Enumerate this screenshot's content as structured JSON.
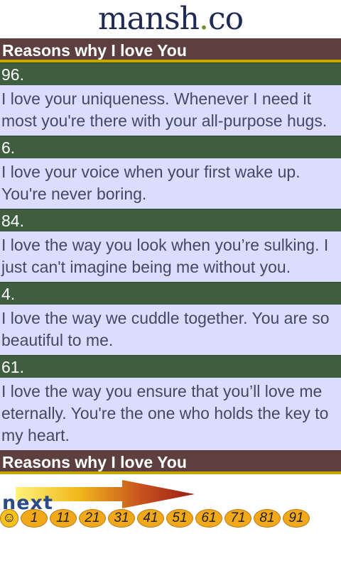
{
  "logo": {
    "main": "mansh",
    "dot": ".",
    "tld": "co"
  },
  "section_title": "Reasons why I love You",
  "items": [
    {
      "num": "96.",
      "text": "I love your uniqueness. Whenever I need it most you're there with your all-purpose hugs."
    },
    {
      "num": "6.",
      "text": "I love your voice when your first wake up. You're never boring."
    },
    {
      "num": "84.",
      "text": "I love the way you look when you’re sulking. I just can't imagine being me without you."
    },
    {
      "num": "4.",
      "text": "I love the way we cuddle together. You are so beautiful to me."
    },
    {
      "num": "61.",
      "text": "I love the way you ensure that you’ll love me eternally. You're the one who holds the key to my heart."
    }
  ],
  "footer": {
    "next_label": "next",
    "smile": "☺",
    "pages": [
      "1",
      "11",
      "21",
      "31",
      "41",
      "51",
      "61",
      "71",
      "81",
      "91"
    ]
  }
}
